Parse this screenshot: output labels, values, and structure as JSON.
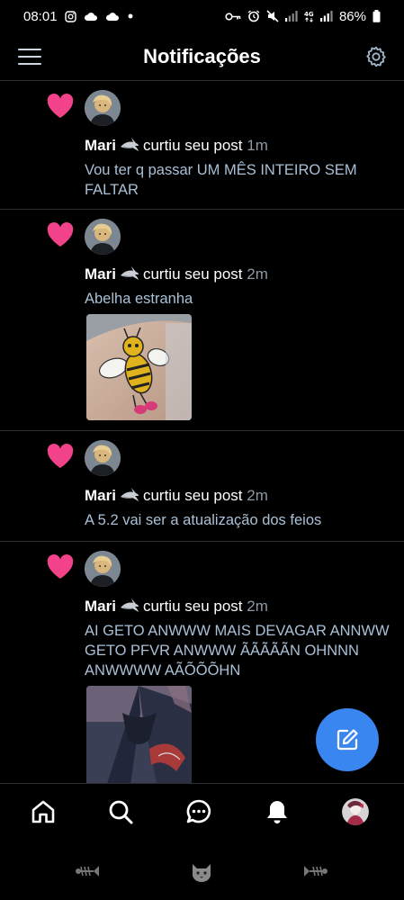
{
  "status_bar": {
    "time": "08:01",
    "battery": "86%",
    "left_icons": [
      "instagram-icon",
      "cloud-icon",
      "cloud-icon",
      "dot-icon"
    ],
    "right_icons": [
      "key-icon",
      "alarm-icon",
      "mute-icon",
      "signal-icon",
      "4g-icon",
      "signal-icon",
      "battery-icon"
    ]
  },
  "header": {
    "title": "Notificações",
    "left_icon": "menu-icon",
    "right_icon": "gear-icon"
  },
  "notifications": [
    {
      "user": "Mari",
      "action": "curtiu seu post",
      "time": "1m",
      "snippet": "Vou ter q passar UM MÊS INTEIRO SEM FALTAR",
      "has_image": false
    },
    {
      "user": "Mari",
      "action": "curtiu seu post",
      "time": "2m",
      "snippet": "Abelha estranha",
      "has_image": true,
      "image": "bee-sticker-photo"
    },
    {
      "user": "Mari",
      "action": "curtiu seu post",
      "time": "2m",
      "snippet": "A 5.2 vai ser a atualização dos feios",
      "has_image": false
    },
    {
      "user": "Mari",
      "action": "curtiu seu post",
      "time": "2m",
      "snippet": "AI GETO ANWWW MAIS DEVAGAR ANNWW GETO PFVR ANWWW ÃÃÃÃÃN OHNNN ANWWWW AÃÕÕÕHN",
      "has_image": true,
      "image": "anime-character-photo"
    }
  ],
  "fab": {
    "icon": "compose-icon"
  },
  "bottom_nav": [
    "home-icon",
    "search-icon",
    "messages-icon",
    "bell-icon",
    "profile-avatar"
  ],
  "system_nav": [
    "fish-bone-icon",
    "cat-icon",
    "fish-bone-icon"
  ],
  "colors": {
    "accent": "#3a86f0",
    "heart": "#f2428a",
    "snippet": "#a9c0d6",
    "muted": "#8b98a5",
    "divider": "#2a2f36"
  }
}
